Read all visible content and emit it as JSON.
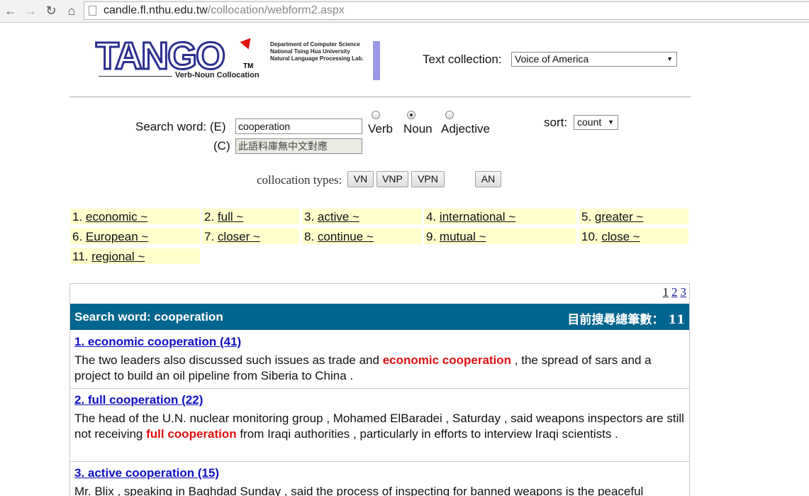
{
  "browser": {
    "url_host": "candle.fl.nthu.edu.tw",
    "url_path": "/collocation/webform2.aspx"
  },
  "header": {
    "logo_text": "TANGO",
    "logo_tm": "TM",
    "logo_sub": "Verb-Noun Collocation",
    "dept_lines": [
      "Department of Computer Science",
      "National Tsing Hua University",
      "Natural Language Processing Lab."
    ],
    "text_collection_label": "Text collection:",
    "text_collection_value": "Voice of America"
  },
  "search": {
    "label_e": "Search word: (E)",
    "label_c": "(C)",
    "word_value": "cooperation",
    "chinese_value": "此語料庫無中文對應",
    "radios": [
      {
        "label": "Verb",
        "checked": false
      },
      {
        "label": "Noun",
        "checked": true
      },
      {
        "label": "Adjective",
        "checked": false
      }
    ],
    "sort_label": "sort:",
    "sort_value": "count",
    "collocation_types_label": "collocation types:",
    "type_buttons": [
      "VN",
      "VNP",
      "VPN",
      "AN"
    ]
  },
  "collocations": [
    {
      "num": "1.",
      "word": "economic ~"
    },
    {
      "num": "2.",
      "word": "full ~"
    },
    {
      "num": "3.",
      "word": "active ~"
    },
    {
      "num": "4.",
      "word": "international ~"
    },
    {
      "num": "5.",
      "word": "greater ~"
    },
    {
      "num": "6.",
      "word": "European ~"
    },
    {
      "num": "7.",
      "word": "closer ~"
    },
    {
      "num": "8.",
      "word": "continue ~"
    },
    {
      "num": "9.",
      "word": "mutual ~"
    },
    {
      "num": "10.",
      "word": "close ~"
    },
    {
      "num": "11.",
      "word": "regional ~"
    }
  ],
  "results": {
    "pages": [
      "1",
      "2",
      "3"
    ],
    "header_left": "Search word: cooperation",
    "header_right": "目前搜尋總筆數： 11",
    "items": [
      {
        "title": "1. economic cooperation (41)",
        "pre": "The two leaders also discussed such issues as trade and ",
        "hl": "economic cooperation",
        "post": " , the spread of sars and a project to build an oil pipeline from Siberia to China ."
      },
      {
        "title": "2. full cooperation (22)",
        "pre": "The head of the U.N. nuclear monitoring group , Mohamed ElBaradei , Saturday , said weapons inspectors are still not receiving ",
        "hl": "full cooperation",
        "post": " from Iraqi authorities , particularly in efforts to interview Iraqi scientists ."
      },
      {
        "title": "3. active cooperation (15)",
        "pre": "Mr. Blix , speaking in Baghdad Sunday , said the process of inspecting for banned weapons is the peaceful",
        "hl": "",
        "post": ""
      }
    ]
  }
}
